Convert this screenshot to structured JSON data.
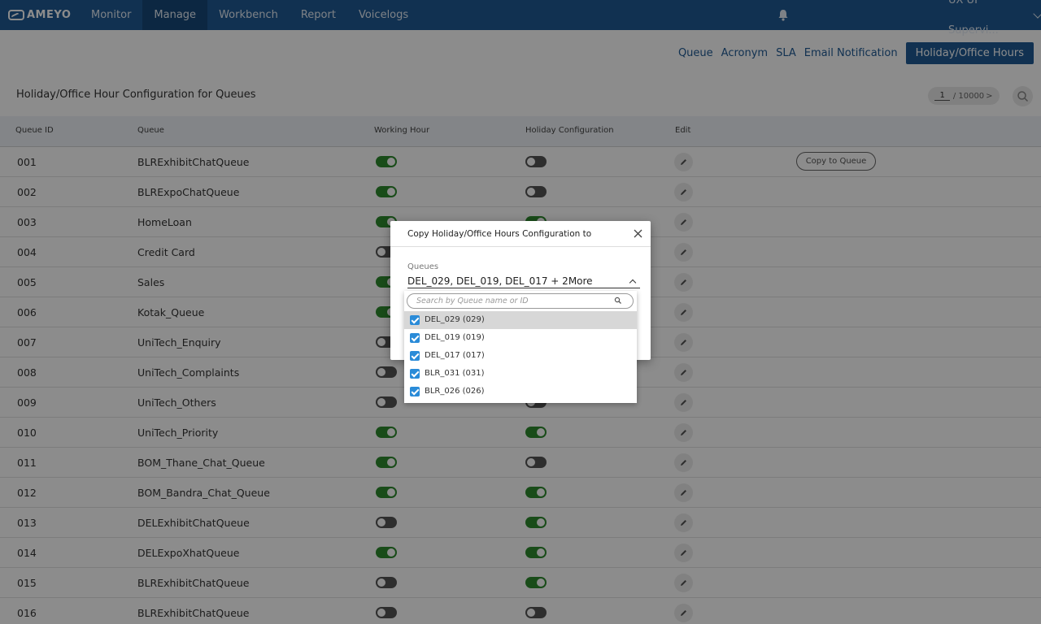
{
  "nav": {
    "brand": "AMEYO",
    "items": [
      {
        "label": "Monitor",
        "active": false
      },
      {
        "label": "Manage",
        "active": true
      },
      {
        "label": "Workbench",
        "active": false
      },
      {
        "label": "Report",
        "active": false
      },
      {
        "label": "Voicelogs",
        "active": false
      }
    ],
    "user": "UX UI Supervi..."
  },
  "subtabs": [
    {
      "label": "Queue",
      "active": false
    },
    {
      "label": "Acronym",
      "active": false
    },
    {
      "label": "SLA",
      "active": false
    },
    {
      "label": "Email Notification",
      "active": false
    },
    {
      "label": "Holiday/Office Hours",
      "active": true
    }
  ],
  "page": {
    "title": "Holiday/Office Hour Configuration for Queues",
    "pager_current": "1",
    "pager_total": "/ 10000",
    "pager_next": ">"
  },
  "table": {
    "headers": [
      "Queue ID",
      "Queue",
      "Working Hour",
      "Holiday Configuration",
      "Edit"
    ],
    "copy_button": "Copy to Queue",
    "rows": [
      {
        "id": "001",
        "queue": "BLRExhibitChatQueue",
        "working": true,
        "holiday": false
      },
      {
        "id": "002",
        "queue": "BLRExpoChatQueue",
        "working": true,
        "holiday": false
      },
      {
        "id": "003",
        "queue": "HomeLoan",
        "working": true,
        "holiday": true
      },
      {
        "id": "004",
        "queue": "Credit Card",
        "working": false,
        "holiday": false
      },
      {
        "id": "005",
        "queue": "Sales",
        "working": true,
        "holiday": false
      },
      {
        "id": "006",
        "queue": "Kotak_Queue",
        "working": true,
        "holiday": false
      },
      {
        "id": "007",
        "queue": "UniTech_Enquiry",
        "working": false,
        "holiday": false
      },
      {
        "id": "008",
        "queue": "UniTech_Complaints",
        "working": false,
        "holiday": false
      },
      {
        "id": "009",
        "queue": "UniTech_Others",
        "working": false,
        "holiday": false
      },
      {
        "id": "010",
        "queue": "UniTech_Priority",
        "working": true,
        "holiday": true
      },
      {
        "id": "011",
        "queue": "BOM_Thane_Chat_Queue",
        "working": true,
        "holiday": false
      },
      {
        "id": "012",
        "queue": "BOM_Bandra_Chat_Queue",
        "working": true,
        "holiday": true
      },
      {
        "id": "013",
        "queue": "DELExhibitChatQueue",
        "working": false,
        "holiday": true
      },
      {
        "id": "014",
        "queue": "DELExpoXhatQueue",
        "working": true,
        "holiday": true
      },
      {
        "id": "015",
        "queue": "BLRExhibitChatQueue",
        "working": false,
        "holiday": true
      },
      {
        "id": "016",
        "queue": "BLRExhibitChatQueue",
        "working": false,
        "holiday": false
      }
    ]
  },
  "dialog": {
    "title": "Copy Holiday/Office Hours Configuration to",
    "field_label": "Queues",
    "field_value": "DEL_029, DEL_019, DEL_017 + 2More",
    "search_placeholder": "Search by Queue name or ID",
    "options": [
      {
        "label": "DEL_029 (029)",
        "checked": true
      },
      {
        "label": "DEL_019 (019)",
        "checked": true
      },
      {
        "label": "DEL_017 (017)",
        "checked": true
      },
      {
        "label": "BLR_031 (031)",
        "checked": true
      },
      {
        "label": "BLR_026 (026)",
        "checked": true
      }
    ]
  },
  "colors": {
    "primary": "#1f5a94",
    "toggle_on": "#2e8b2e",
    "toggle_off": "#555555",
    "checkbox": "#2a8bd8"
  }
}
